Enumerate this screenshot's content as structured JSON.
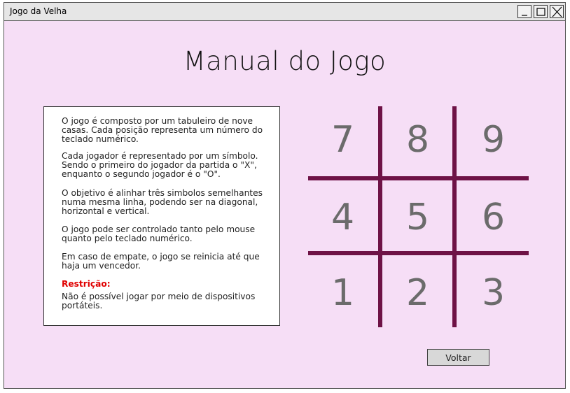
{
  "window": {
    "title": "Jogo da Velha"
  },
  "page": {
    "heading": "Manual do Jogo",
    "back_button": "Voltar"
  },
  "manual": {
    "p1": "O jogo é composto por um tabuleiro de nove casas. Cada posição representa um número do teclado numérico.",
    "p2": "Cada jogador é representado por um símbolo. Sendo o primeiro do jogador da partida o \"X\", enquanto o segundo jogador é o \"O\".",
    "p3": "O objetivo é alinhar três simbolos semelhantes numa mesma linha, podendo ser na diagonal, horizontal e vertical.",
    "p4": "O jogo pode ser controlado tanto pelo mouse quanto pelo teclado numérico.",
    "p5": "Em caso de empate, o jogo se reinicia até que haja um vencedor.",
    "restriction_label": "Restrição:",
    "restriction_text": "Não é possível jogar por meio de dispositivos portáteis."
  },
  "board": {
    "cells": [
      "7",
      "8",
      "9",
      "4",
      "5",
      "6",
      "1",
      "2",
      "3"
    ],
    "line_color": "#6e1246",
    "number_color": "#6b6b6b"
  },
  "colors": {
    "background": "#f6def6"
  }
}
